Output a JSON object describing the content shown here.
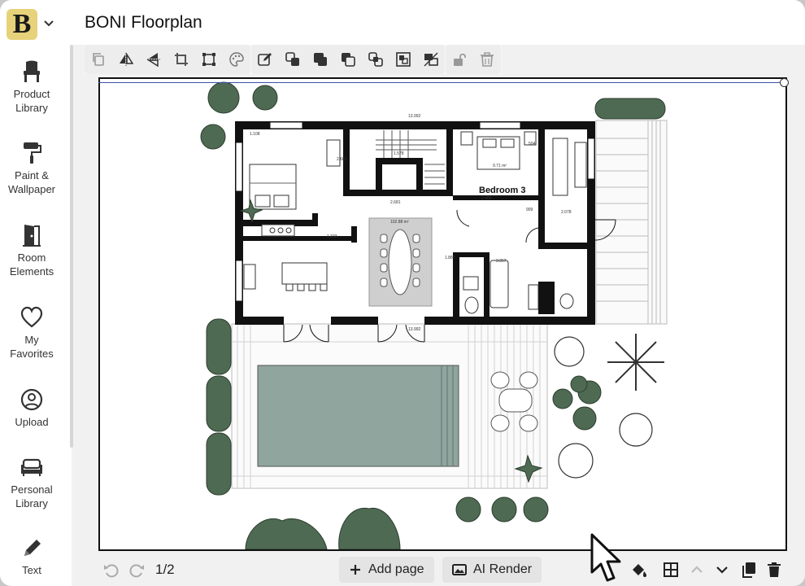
{
  "app": {
    "title": "BONI Floorplan",
    "logo_letter": "B"
  },
  "sidebar": {
    "items": [
      {
        "label_line1": "Product",
        "label_line2": "Library",
        "icon": "chair-icon"
      },
      {
        "label_line1": "Paint &",
        "label_line2": "Wallpaper",
        "icon": "paint-roller-icon"
      },
      {
        "label_line1": "Room",
        "label_line2": "Elements",
        "icon": "door-icon"
      },
      {
        "label_line1": "My",
        "label_line2": "Favorites",
        "icon": "heart-icon"
      },
      {
        "label_line1": "Upload",
        "label_line2": "",
        "icon": "user-circle-icon"
      },
      {
        "label_line1": "Personal",
        "label_line2": "Library",
        "icon": "sofa-icon"
      },
      {
        "label_line1": "Text",
        "label_line2": "",
        "icon": "pencil-icon"
      }
    ]
  },
  "toolbar": {
    "icons": [
      "copy-icon",
      "flip-horizontal-icon",
      "flip-vertical-icon",
      "crop-icon",
      "transform-icon",
      "palette-icon",
      "edit-icon",
      "bring-forward-icon",
      "bring-to-front-icon",
      "send-backward-icon",
      "send-to-back-icon",
      "group-icon",
      "ungroup-icon",
      "unlock-icon",
      "trash-icon"
    ]
  },
  "canvas": {
    "room_label": "Bedroom 3",
    "dimension_labels": [
      "13.992",
      "1.108",
      "2.681",
      "1.578",
      "2.681",
      "9.71 m²",
      "2.484",
      "504",
      "909",
      "2.078",
      "102.88 m²",
      "1.333",
      "1.880",
      "3.357",
      "13.992"
    ]
  },
  "bottombar": {
    "page_indicator": "1/2",
    "add_page_label": "Add page",
    "ai_render_label": "AI Render"
  },
  "colors": {
    "logo_bg": "#e6d27a",
    "pool": "#8fa59e",
    "tree": "#4f6a52",
    "wall": "#111111"
  }
}
